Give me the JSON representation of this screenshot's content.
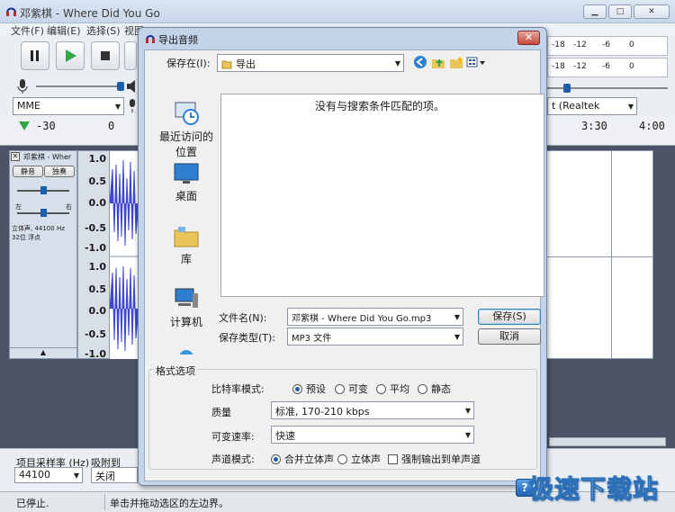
{
  "app": {
    "title": "邓紫棋 - Where Did You Go"
  },
  "menu": [
    "文件(F)",
    "编辑(E)",
    "选择(S)",
    "视图"
  ],
  "toolbar": {
    "device_host": "MME",
    "output_device": "t (Realtek"
  },
  "meter_ticks": [
    "-18",
    "-12",
    "-6",
    "0"
  ],
  "ruler": {
    "left": "-30",
    "zero": "0",
    "t1": "3:30",
    "t2": "4:00"
  },
  "track": {
    "name": "邓紫棋 - Wher",
    "mute": "静音",
    "solo": "独奏",
    "left": "左",
    "right": "右",
    "info1": "立体声, 44100 Hz",
    "info2": "32位 浮点"
  },
  "vscale": [
    "1.0",
    "0.5",
    "0.0",
    "-0.5",
    "-1.0",
    "1.0",
    "0.5",
    "0.0",
    "-0.5",
    "-1.0"
  ],
  "bottom": {
    "rate_label": "项目采样率 (Hz)",
    "rate_value": "44100",
    "snap_label": "吸附到",
    "snap_value": "关闭"
  },
  "status": {
    "left": "已停止.",
    "hint": "单击并拖动选区的左边界。"
  },
  "dialog": {
    "title": "导出音频",
    "save_in_label": "保存在(I):",
    "save_in_value": "导出",
    "empty_msg": "没有与搜索条件匹配的项。",
    "places": [
      "最近访问的位置",
      "桌面",
      "库",
      "计算机"
    ],
    "filename_label": "文件名(N):",
    "filename_value": "邓紫棋 - Where Did You Go.mp3",
    "filetype_label": "保存类型(T):",
    "filetype_value": "MP3 文件",
    "save_button": "保存(S)",
    "cancel_button": "取消",
    "options_group": "格式选项",
    "bitrate_mode_label": "比特率模式:",
    "bitrate_modes": [
      "预设",
      "可变",
      "平均",
      "静态"
    ],
    "quality_label": "质量",
    "quality_value": "标准, 170-210 kbps",
    "var_speed_label": "可变速率:",
    "var_speed_value": "快速",
    "channel_label": "声道模式:",
    "channel_modes": [
      "合并立体声",
      "立体声"
    ],
    "force_mono": "强制输出到单声道"
  },
  "watermark": "极速下载站",
  "colors": {
    "accent": "#1d5ea8",
    "wave": "#3f48cc",
    "track_bg": "#4a5466"
  }
}
